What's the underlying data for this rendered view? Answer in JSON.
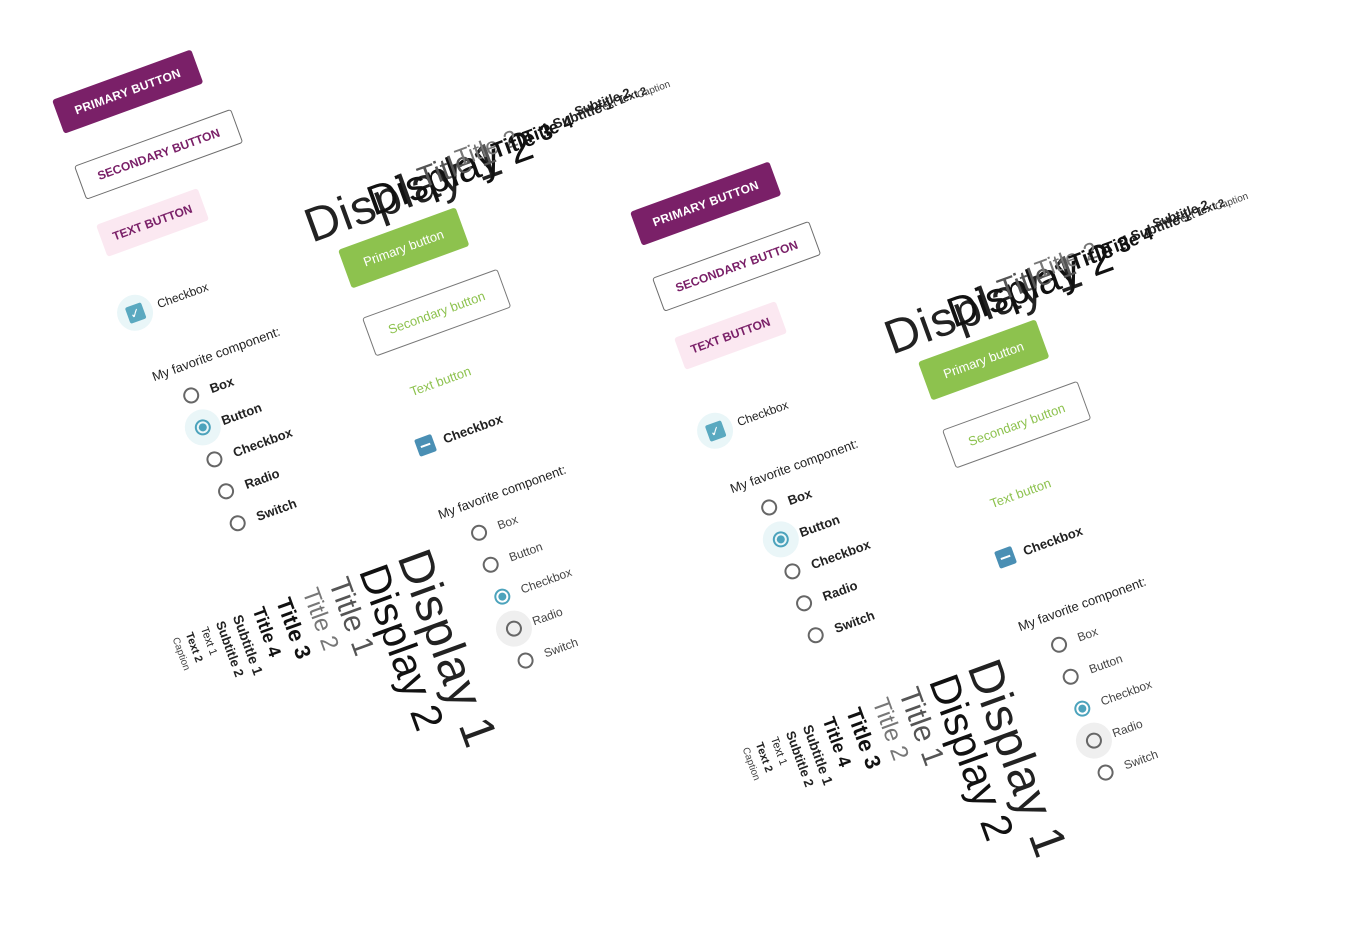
{
  "purple_buttons": {
    "primary": "PRIMARY BUTTON",
    "secondary": "SECONDARY BUTTON",
    "text": "TEXT BUTTON"
  },
  "green_buttons": {
    "primary": "Primary button",
    "secondary": "Secondary button",
    "text": "Text button"
  },
  "checkbox": {
    "label": "Checkbox"
  },
  "radio_group": {
    "label": "My favorite component:",
    "options": [
      "Box",
      "Button",
      "Checkbox",
      "Radio",
      "Switch"
    ]
  },
  "typography": {
    "display1": "Display 1",
    "display2": "Display 2",
    "title1": "Title 1",
    "title2": "Title 2",
    "title3": "Title 3",
    "title4": "Title 4",
    "subtitle1": "Subtitle 1",
    "subtitle2": "Subtitle 2",
    "text1": "Text 1",
    "text2": "Text 2",
    "caption": "Caption"
  },
  "colors": {
    "purple": "#7a2068",
    "green": "#8dc24e",
    "teal": "#4ca3bc"
  }
}
